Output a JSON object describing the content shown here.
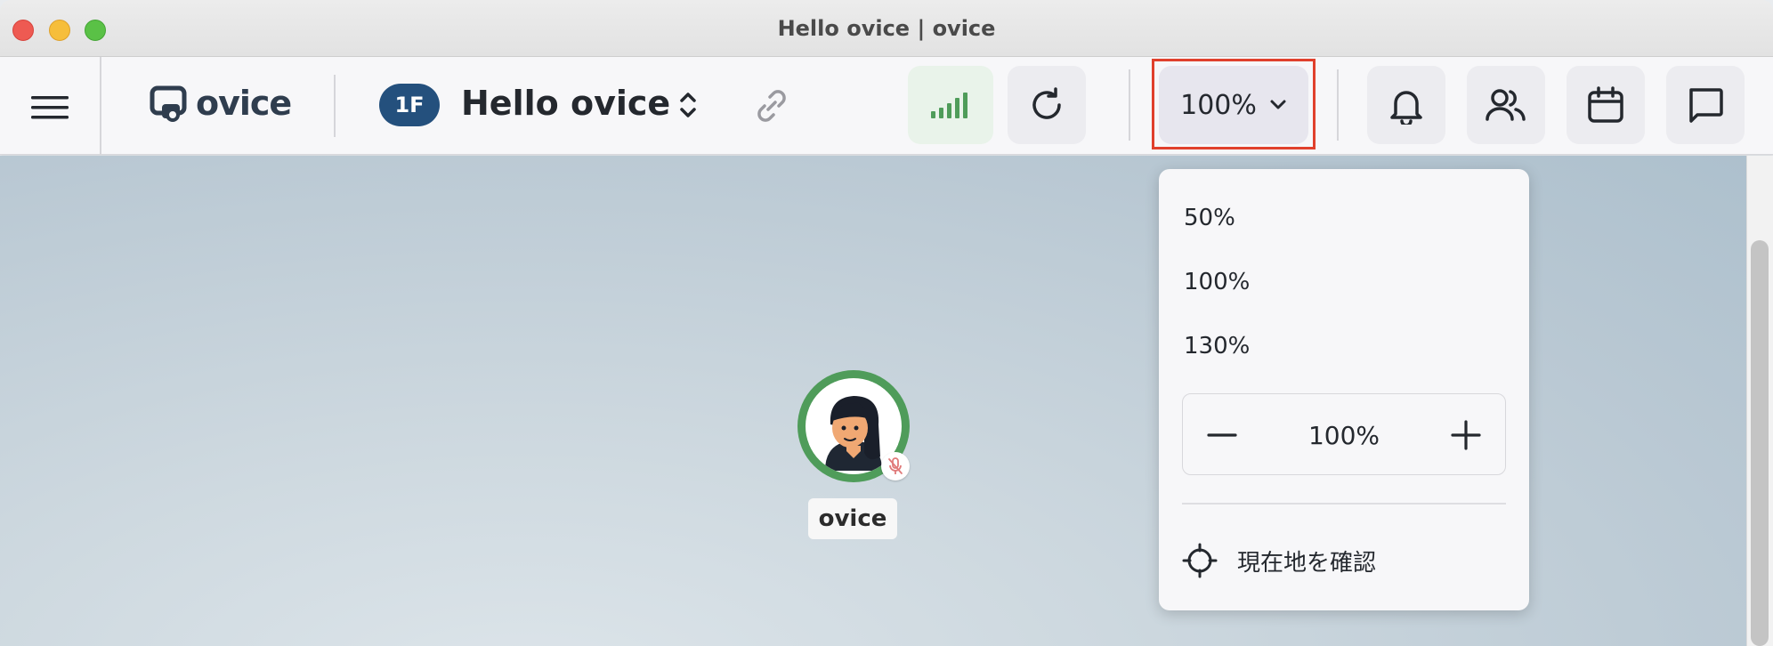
{
  "window": {
    "title": "Hello ovice | ovice"
  },
  "header": {
    "logo_text": "ovice",
    "floor_badge": "1F",
    "space_name": "Hello ovice",
    "zoom_label": "100%",
    "connection_status": "strong",
    "accent_color": "#24507d",
    "highlight_color": "#e0402c",
    "icons": [
      "menu-icon",
      "ovice-logo-icon",
      "floor-switch-icon",
      "link-icon",
      "signal-icon",
      "reload-icon",
      "chevron-down-icon",
      "bell-icon",
      "members-icon",
      "calendar-icon",
      "chat-icon"
    ]
  },
  "zoom_menu": {
    "options": [
      "50%",
      "100%",
      "130%"
    ],
    "stepper_value": "100%",
    "locate_label": "現在地を確認"
  },
  "canvas": {
    "avatar_name": "ovice",
    "avatar_status_color": "#4f9c5a",
    "mic_muted": true
  }
}
